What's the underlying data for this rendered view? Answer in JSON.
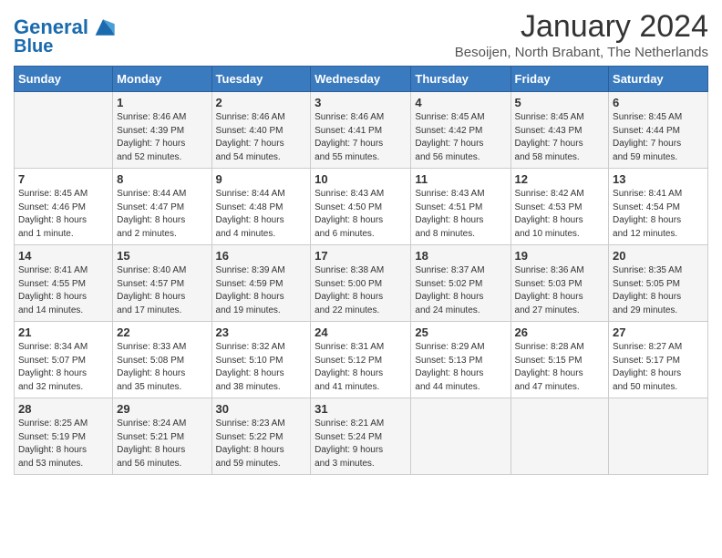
{
  "header": {
    "logo_line1": "General",
    "logo_line2": "Blue",
    "month_year": "January 2024",
    "location": "Besoijen, North Brabant, The Netherlands"
  },
  "days_of_week": [
    "Sunday",
    "Monday",
    "Tuesday",
    "Wednesday",
    "Thursday",
    "Friday",
    "Saturday"
  ],
  "weeks": [
    [
      {
        "day": "",
        "info": ""
      },
      {
        "day": "1",
        "info": "Sunrise: 8:46 AM\nSunset: 4:39 PM\nDaylight: 7 hours\nand 52 minutes."
      },
      {
        "day": "2",
        "info": "Sunrise: 8:46 AM\nSunset: 4:40 PM\nDaylight: 7 hours\nand 54 minutes."
      },
      {
        "day": "3",
        "info": "Sunrise: 8:46 AM\nSunset: 4:41 PM\nDaylight: 7 hours\nand 55 minutes."
      },
      {
        "day": "4",
        "info": "Sunrise: 8:45 AM\nSunset: 4:42 PM\nDaylight: 7 hours\nand 56 minutes."
      },
      {
        "day": "5",
        "info": "Sunrise: 8:45 AM\nSunset: 4:43 PM\nDaylight: 7 hours\nand 58 minutes."
      },
      {
        "day": "6",
        "info": "Sunrise: 8:45 AM\nSunset: 4:44 PM\nDaylight: 7 hours\nand 59 minutes."
      }
    ],
    [
      {
        "day": "7",
        "info": "Sunrise: 8:45 AM\nSunset: 4:46 PM\nDaylight: 8 hours\nand 1 minute."
      },
      {
        "day": "8",
        "info": "Sunrise: 8:44 AM\nSunset: 4:47 PM\nDaylight: 8 hours\nand 2 minutes."
      },
      {
        "day": "9",
        "info": "Sunrise: 8:44 AM\nSunset: 4:48 PM\nDaylight: 8 hours\nand 4 minutes."
      },
      {
        "day": "10",
        "info": "Sunrise: 8:43 AM\nSunset: 4:50 PM\nDaylight: 8 hours\nand 6 minutes."
      },
      {
        "day": "11",
        "info": "Sunrise: 8:43 AM\nSunset: 4:51 PM\nDaylight: 8 hours\nand 8 minutes."
      },
      {
        "day": "12",
        "info": "Sunrise: 8:42 AM\nSunset: 4:53 PM\nDaylight: 8 hours\nand 10 minutes."
      },
      {
        "day": "13",
        "info": "Sunrise: 8:41 AM\nSunset: 4:54 PM\nDaylight: 8 hours\nand 12 minutes."
      }
    ],
    [
      {
        "day": "14",
        "info": "Sunrise: 8:41 AM\nSunset: 4:55 PM\nDaylight: 8 hours\nand 14 minutes."
      },
      {
        "day": "15",
        "info": "Sunrise: 8:40 AM\nSunset: 4:57 PM\nDaylight: 8 hours\nand 17 minutes."
      },
      {
        "day": "16",
        "info": "Sunrise: 8:39 AM\nSunset: 4:59 PM\nDaylight: 8 hours\nand 19 minutes."
      },
      {
        "day": "17",
        "info": "Sunrise: 8:38 AM\nSunset: 5:00 PM\nDaylight: 8 hours\nand 22 minutes."
      },
      {
        "day": "18",
        "info": "Sunrise: 8:37 AM\nSunset: 5:02 PM\nDaylight: 8 hours\nand 24 minutes."
      },
      {
        "day": "19",
        "info": "Sunrise: 8:36 AM\nSunset: 5:03 PM\nDaylight: 8 hours\nand 27 minutes."
      },
      {
        "day": "20",
        "info": "Sunrise: 8:35 AM\nSunset: 5:05 PM\nDaylight: 8 hours\nand 29 minutes."
      }
    ],
    [
      {
        "day": "21",
        "info": "Sunrise: 8:34 AM\nSunset: 5:07 PM\nDaylight: 8 hours\nand 32 minutes."
      },
      {
        "day": "22",
        "info": "Sunrise: 8:33 AM\nSunset: 5:08 PM\nDaylight: 8 hours\nand 35 minutes."
      },
      {
        "day": "23",
        "info": "Sunrise: 8:32 AM\nSunset: 5:10 PM\nDaylight: 8 hours\nand 38 minutes."
      },
      {
        "day": "24",
        "info": "Sunrise: 8:31 AM\nSunset: 5:12 PM\nDaylight: 8 hours\nand 41 minutes."
      },
      {
        "day": "25",
        "info": "Sunrise: 8:29 AM\nSunset: 5:13 PM\nDaylight: 8 hours\nand 44 minutes."
      },
      {
        "day": "26",
        "info": "Sunrise: 8:28 AM\nSunset: 5:15 PM\nDaylight: 8 hours\nand 47 minutes."
      },
      {
        "day": "27",
        "info": "Sunrise: 8:27 AM\nSunset: 5:17 PM\nDaylight: 8 hours\nand 50 minutes."
      }
    ],
    [
      {
        "day": "28",
        "info": "Sunrise: 8:25 AM\nSunset: 5:19 PM\nDaylight: 8 hours\nand 53 minutes."
      },
      {
        "day": "29",
        "info": "Sunrise: 8:24 AM\nSunset: 5:21 PM\nDaylight: 8 hours\nand 56 minutes."
      },
      {
        "day": "30",
        "info": "Sunrise: 8:23 AM\nSunset: 5:22 PM\nDaylight: 8 hours\nand 59 minutes."
      },
      {
        "day": "31",
        "info": "Sunrise: 8:21 AM\nSunset: 5:24 PM\nDaylight: 9 hours\nand 3 minutes."
      },
      {
        "day": "",
        "info": ""
      },
      {
        "day": "",
        "info": ""
      },
      {
        "day": "",
        "info": ""
      }
    ]
  ]
}
